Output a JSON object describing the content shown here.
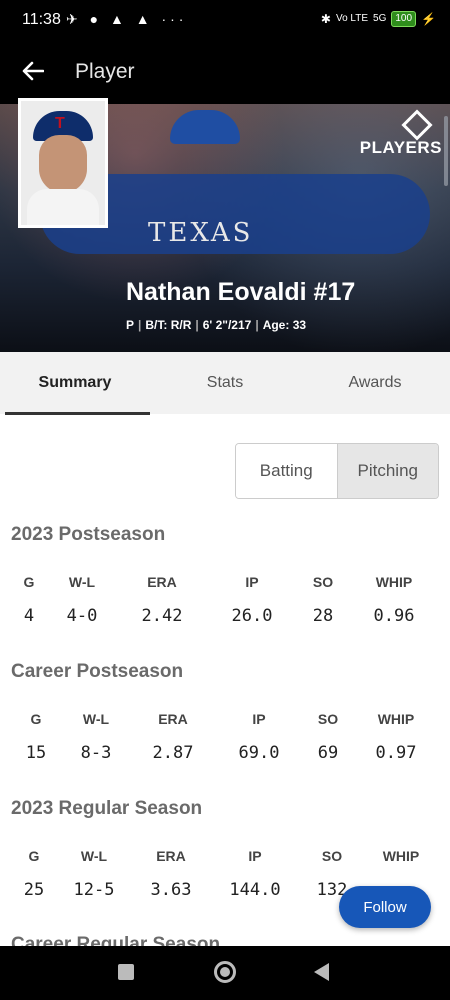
{
  "status_bar": {
    "time": "11:38",
    "left_icons": "✈ ● ▲ ▲ ···",
    "net_badge": "Vo LTE",
    "signal_label": "5G",
    "battery": "100"
  },
  "header": {
    "title": "Player"
  },
  "hero": {
    "brand": "PLAYERS",
    "brand_prefix": "MLB",
    "jersey_text": "TEXAS",
    "player_name": "Nathan Eovaldi #17",
    "position": "P",
    "bats_throws": "B/T: R/R",
    "height_weight": "6' 2\"/217",
    "age": "Age: 33"
  },
  "tabs": [
    {
      "label": "Summary"
    },
    {
      "label": "Stats"
    },
    {
      "label": "Awards"
    }
  ],
  "toggle": {
    "batting": "Batting",
    "pitching": "Pitching"
  },
  "sections": [
    {
      "title": "2023 Postseason",
      "headers": [
        "G",
        "W-L",
        "ERA",
        "IP",
        "SO",
        "WHIP"
      ],
      "values": [
        "4",
        "4-0",
        "2.42",
        "26.0",
        "28",
        "0.96"
      ]
    },
    {
      "title": "Career Postseason",
      "headers": [
        "G",
        "W-L",
        "ERA",
        "IP",
        "SO",
        "WHIP"
      ],
      "values": [
        "15",
        "8-3",
        "2.87",
        "69.0",
        "69",
        "0.97"
      ]
    },
    {
      "title": "2023 Regular Season",
      "headers": [
        "G",
        "W-L",
        "ERA",
        "IP",
        "SO",
        "WHIP"
      ],
      "values": [
        "25",
        "12-5",
        "3.63",
        "144.0",
        "132",
        ""
      ]
    },
    {
      "title": "Career Regular Season"
    }
  ],
  "follow_button": "Follow",
  "colors": {
    "accent_blue": "#1757b8",
    "tab_bg": "#f2f2f2",
    "battery_green": "#2f8d1c"
  }
}
